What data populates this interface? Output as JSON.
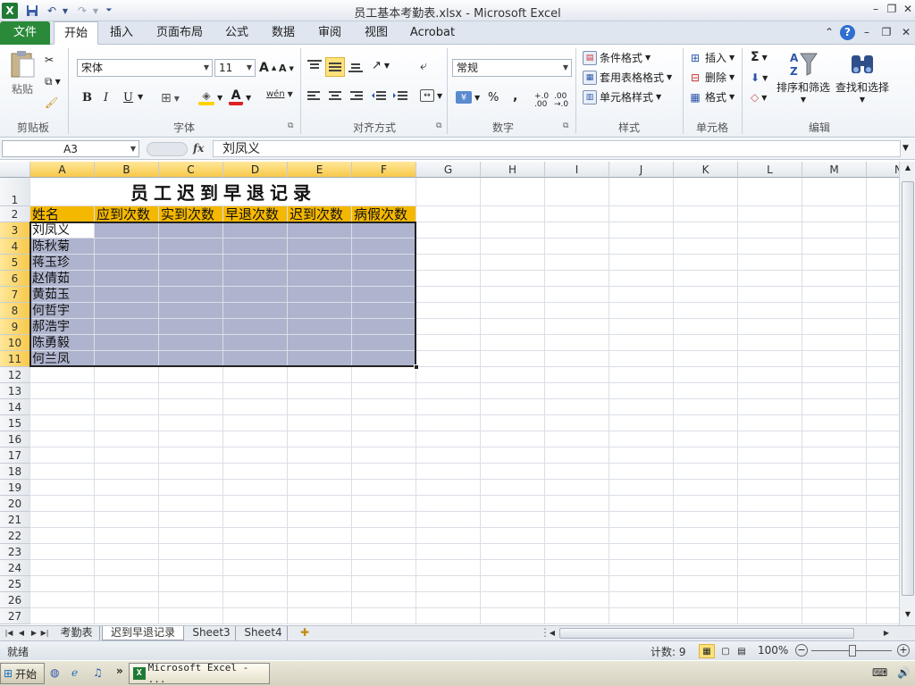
{
  "window": {
    "title": "员工基本考勤表.xlsx - Microsoft Excel"
  },
  "qat": {
    "excel_icon": "X",
    "undo": "↶",
    "redo": "↷"
  },
  "tabs": [
    "文件",
    "开始",
    "插入",
    "页面布局",
    "公式",
    "数据",
    "审阅",
    "视图",
    "Acrobat"
  ],
  "ribbon": {
    "clipboard": {
      "label": "剪贴板",
      "paste": "粘贴"
    },
    "font": {
      "label": "字体",
      "name": "宋体",
      "size": "11",
      "bold": "B",
      "italic": "I",
      "underline": "U",
      "grow": "A",
      "shrink": "A",
      "wen": "wén",
      "font_color_letter": "A"
    },
    "alignment": {
      "label": "对齐方式"
    },
    "number": {
      "label": "数字",
      "format": "常规",
      "percent": "%",
      "comma": ",",
      "inc": "+.0 .00",
      "dec": ".00 →.0"
    },
    "styles": {
      "label": "样式",
      "conditional": "条件格式",
      "table": "套用表格格式",
      "cell": "单元格样式"
    },
    "cells": {
      "label": "单元格",
      "insert": "插入",
      "delete": "删除",
      "format": "格式"
    },
    "editing": {
      "label": "编辑",
      "sum": "Σ",
      "sort": "排序和筛选",
      "find": "查找和选择"
    }
  },
  "formula": {
    "namebox": "A3",
    "fx": "fx",
    "value": "刘凤义"
  },
  "sheet": {
    "columns": [
      "A",
      "B",
      "C",
      "D",
      "E",
      "F",
      "G",
      "H",
      "I",
      "J",
      "K",
      "L",
      "M",
      "N"
    ],
    "rows": [
      "1",
      "2",
      "3",
      "4",
      "5",
      "6",
      "7",
      "8",
      "9",
      "10",
      "11",
      "12",
      "13",
      "14",
      "15",
      "16",
      "17",
      "18",
      "19",
      "20",
      "21",
      "22",
      "23",
      "24",
      "25",
      "26",
      "27"
    ],
    "title": "员工迟到早退记录",
    "headers": [
      "姓名",
      "应到次数",
      "实到次数",
      "早退次数",
      "迟到次数",
      "病假次数"
    ],
    "names": [
      "刘凤义",
      "陈秋菊",
      "蒋玉珍",
      "赵倩茹",
      "黄茹玉",
      "何哲宇",
      "郝浩宇",
      "陈勇毅",
      "何兰凤"
    ]
  },
  "sheettabs": [
    "考勤表",
    "迟到早退记录",
    "Sheet3",
    "Sheet4"
  ],
  "status": {
    "ready": "就绪",
    "count": "计数: 9",
    "zoom": "100%"
  },
  "taskbar": {
    "start": "开始",
    "task": "Microsoft Excel - ..."
  },
  "colors": {
    "header_fill": "#f5b800",
    "selection": "#aeb4ce",
    "file_tab": "#2a8a3a"
  }
}
